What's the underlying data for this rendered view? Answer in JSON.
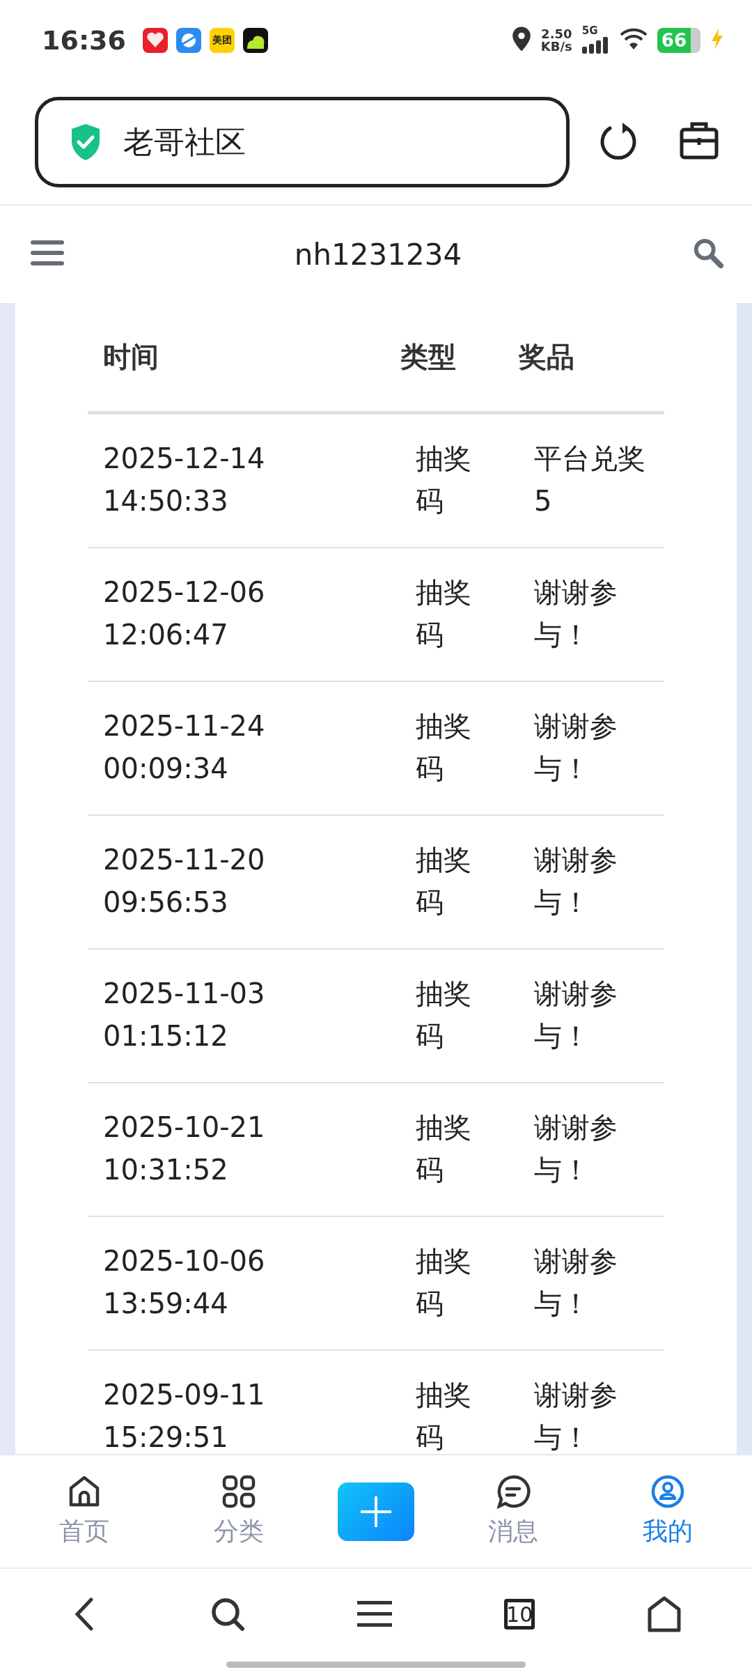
{
  "status_bar": {
    "time": "16:36",
    "notification_icons": [
      {
        "kind": "heart"
      },
      {
        "kind": "planet"
      },
      {
        "kind": "label",
        "text": "美团"
      },
      {
        "kind": "cloud"
      }
    ],
    "network_speed": "2.50",
    "speed_unit": "KB/s",
    "network_type": "5G",
    "battery": "66"
  },
  "address_bar": {
    "title": "老哥社区"
  },
  "site_header": {
    "title": "nh1231234"
  },
  "table": {
    "columns": [
      "时间",
      "类型",
      "奖品"
    ],
    "rows": [
      {
        "time": "2025-12-14 14:50:33",
        "type": "抽奖码",
        "prize": "平台兑奖5"
      },
      {
        "time": "2025-12-06 12:06:47",
        "type": "抽奖码",
        "prize": "谢谢参与！"
      },
      {
        "time": "2025-11-24 00:09:34",
        "type": "抽奖码",
        "prize": "谢谢参与！"
      },
      {
        "time": "2025-11-20 09:56:53",
        "type": "抽奖码",
        "prize": "谢谢参与！"
      },
      {
        "time": "2025-11-03 01:15:12",
        "type": "抽奖码",
        "prize": "谢谢参与！"
      },
      {
        "time": "2025-10-21 10:31:52",
        "type": "抽奖码",
        "prize": "谢谢参与！"
      },
      {
        "time": "2025-10-06 13:59:44",
        "type": "抽奖码",
        "prize": "谢谢参与！"
      },
      {
        "time": "2025-09-11 15:29:51",
        "type": "抽奖码",
        "prize": "谢谢参与！"
      }
    ]
  },
  "tab_bar": [
    {
      "kind": "home",
      "label": "首页",
      "selected": false
    },
    {
      "kind": "category",
      "label": "分类",
      "selected": false
    },
    {
      "kind": "add",
      "selected": false
    },
    {
      "kind": "message",
      "label": "消息",
      "selected": false
    },
    {
      "kind": "profile",
      "label": "我的",
      "selected": true
    }
  ],
  "browser_toolbar": {
    "tab_count": "10"
  }
}
